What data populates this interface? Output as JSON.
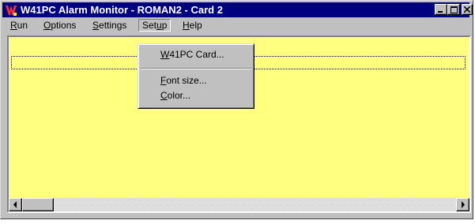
{
  "window": {
    "title": "W41PC Alarm Monitor - ROMAN2 - Card 2",
    "icon": "w41pc-app-icon",
    "caption_buttons": [
      "minimize-icon",
      "maximize-icon",
      "close-icon"
    ]
  },
  "menubar": {
    "items": [
      {
        "pre": "",
        "key": "R",
        "post": "un"
      },
      {
        "pre": "",
        "key": "O",
        "post": "ptions"
      },
      {
        "pre": "",
        "key": "S",
        "post": "ettings"
      },
      {
        "pre": "Set",
        "key": "u",
        "post": "p"
      },
      {
        "pre": "",
        "key": "H",
        "post": "elp"
      }
    ]
  },
  "setup_menu": {
    "items": [
      {
        "pre": "",
        "key": "W",
        "post": "41PC Card..."
      },
      {
        "pre": "",
        "key": "F",
        "post": "ont size..."
      },
      {
        "pre": "",
        "key": "C",
        "post": "olor..."
      }
    ]
  },
  "colors": {
    "title_bar": "#000080",
    "list_background": "#ffff80",
    "chrome": "#c0c0c0"
  }
}
